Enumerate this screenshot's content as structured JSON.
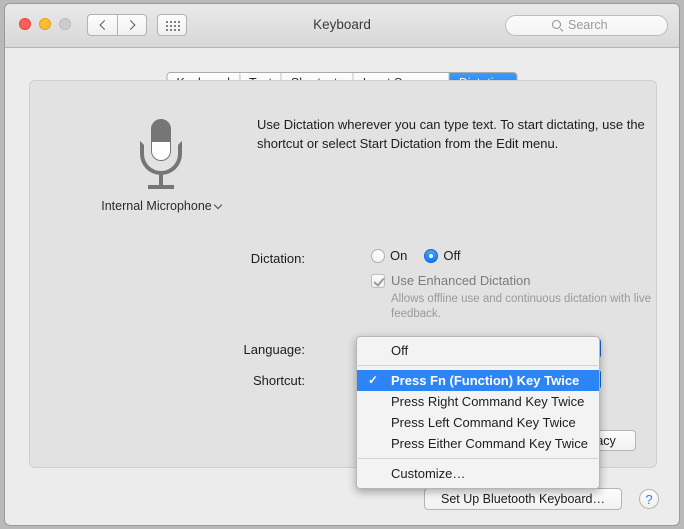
{
  "window": {
    "title": "Keyboard",
    "traffic_lights": [
      "close",
      "minimize",
      "zoom"
    ]
  },
  "toolbar": {
    "back_icon": "chevron-left-icon",
    "forward_icon": "chevron-right-icon",
    "grid_icon": "show-all-grid-icon",
    "search_placeholder": "Search",
    "search_value": "",
    "search_icon": "search-icon"
  },
  "tabs": [
    {
      "label": "Keyboard",
      "selected": false
    },
    {
      "label": "Text",
      "selected": false
    },
    {
      "label": "Shortcuts",
      "selected": false
    },
    {
      "label": "Input Sources",
      "selected": false
    },
    {
      "label": "Dictation",
      "selected": true
    }
  ],
  "main": {
    "intro": "Use Dictation wherever you can type text. To start dictating, use the shortcut or select Start Dictation from the Edit menu.",
    "microphone": {
      "icon": "microphone-icon",
      "label": "Internal Microphone",
      "chevron_icon": "chevron-down-icon"
    },
    "dictation": {
      "label": "Dictation:",
      "on_label": "On",
      "off_label": "Off",
      "selected": "Off"
    },
    "enhanced": {
      "label": "Use Enhanced Dictation",
      "checked": true,
      "enabled": false,
      "help": "Allows offline use and continuous dictation with live feedback."
    },
    "language": {
      "label": "Language:",
      "value": ""
    },
    "shortcut": {
      "label": "Shortcut:",
      "value": "Press Fn (Function) Key Twice"
    }
  },
  "menu": {
    "check_glyph": "✓",
    "groups": [
      {
        "items": [
          {
            "label": "Off",
            "checked": false,
            "highlight": false
          }
        ]
      },
      {
        "items": [
          {
            "label": "Press Fn (Function) Key Twice",
            "checked": true,
            "highlight": true
          },
          {
            "label": "Press Right Command Key Twice",
            "checked": false,
            "highlight": false
          },
          {
            "label": "Press Left Command Key Twice",
            "checked": false,
            "highlight": false
          },
          {
            "label": "Press Either Command Key Twice",
            "checked": false,
            "highlight": false
          }
        ]
      },
      {
        "items": [
          {
            "label": "Customize…",
            "checked": false,
            "highlight": false
          }
        ]
      }
    ]
  },
  "buttons": {
    "about": "About Dictation and Privacy",
    "bluetooth": "Set Up Bluetooth Keyboard…",
    "help": "?"
  },
  "colors": {
    "accent_blue": "#1379ef",
    "menu_highlight": "#2d84f5",
    "window_bg": "#ececec",
    "card_bg": "#e2e2e2",
    "help_blue": "#2f7ff0"
  }
}
